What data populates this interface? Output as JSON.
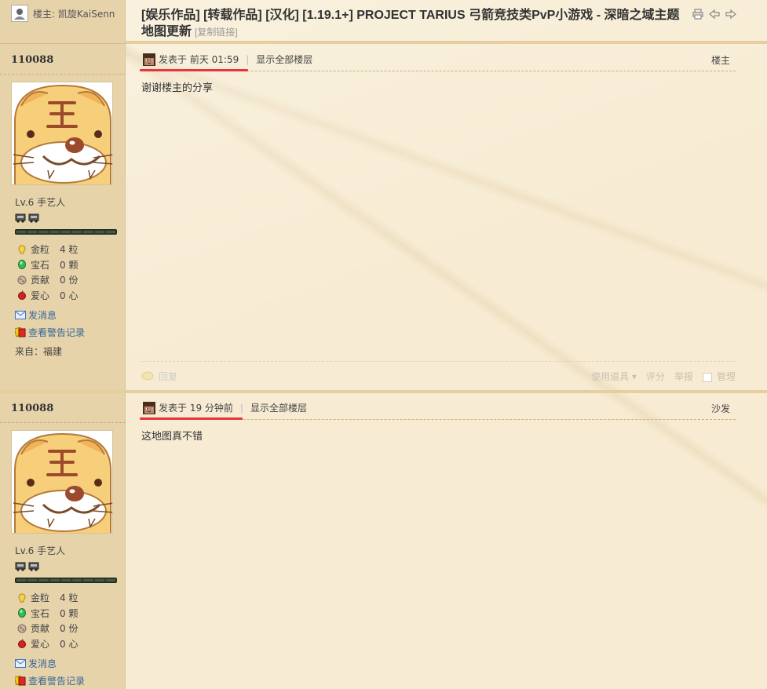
{
  "header": {
    "op_label": "楼主: 凯旋KaiSenn",
    "title": "[娱乐作品] [转载作品] [汉化] [1.19.1+] PROJECT TARIUS 弓箭竞技类PvP小游戏 - 深暗之域主题地图更新",
    "copy_link": "[复制链接]",
    "icons": [
      "print-icon",
      "prev-thread-icon",
      "next-thread-icon"
    ]
  },
  "posts": [
    {
      "uid": "110088",
      "level": "Lv.6 手艺人",
      "stats": [
        {
          "label": "金粒",
          "value": "4 粒",
          "icon": "gold-nugget-icon"
        },
        {
          "label": "宝石",
          "value": "0 颗",
          "icon": "emerald-icon"
        },
        {
          "label": "贡献",
          "value": "0 份",
          "icon": "contribution-icon"
        },
        {
          "label": "爱心",
          "value": "0 心",
          "icon": "apple-heart-icon"
        }
      ],
      "actions": {
        "message": "发消息",
        "warnings": "查看警告记录"
      },
      "from": "来自：福建",
      "posted": "发表于 前天 01:59",
      "show_all": "显示全部楼层",
      "floor": "楼主",
      "content": "谢谢楼主的分享",
      "footer": {
        "reply": "回复",
        "use_item": "使用道具",
        "rate": "评分",
        "report": "举报",
        "manage": "管理"
      }
    },
    {
      "uid": "110088",
      "level": "Lv.6 手艺人",
      "stats": [
        {
          "label": "金粒",
          "value": "4 粒",
          "icon": "gold-nugget-icon"
        },
        {
          "label": "宝石",
          "value": "0 颗",
          "icon": "emerald-icon"
        },
        {
          "label": "贡献",
          "value": "0 份",
          "icon": "contribution-icon"
        },
        {
          "label": "爱心",
          "value": "0 心",
          "icon": "apple-heart-icon"
        }
      ],
      "actions": {
        "message": "发消息",
        "warnings": "查看警告记录"
      },
      "posted": "发表于 19 分钟前",
      "show_all": "显示全部楼层",
      "floor": "沙发",
      "content": "这地图真不错"
    }
  ],
  "colors": {
    "side_bg": "#e7d3aa",
    "main_bg": "#f7ecd3",
    "separator": "#e6cf9e",
    "link": "#336699",
    "highlight": "#e8343a"
  }
}
